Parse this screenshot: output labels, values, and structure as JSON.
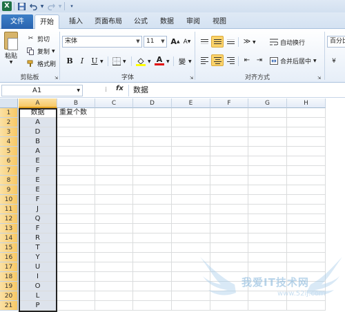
{
  "qat": {
    "app_icon": "X",
    "icons": [
      "save-icon",
      "undo-icon",
      "redo-icon",
      "customize-qat-icon"
    ]
  },
  "tabs": [
    "文件",
    "开始",
    "插入",
    "页面布局",
    "公式",
    "数据",
    "审阅",
    "视图"
  ],
  "ribbon": {
    "clipboard": {
      "paste": "粘贴",
      "cut": "剪切",
      "copy": "复制",
      "format_painter": "格式刷",
      "label": "剪贴板"
    },
    "font": {
      "name": "宋体",
      "size": "11",
      "grow": "A",
      "shrink": "A",
      "bold": "B",
      "italic": "I",
      "underline": "U",
      "font_color_letter": "A",
      "phonetic": "變",
      "label": "字体"
    },
    "alignment": {
      "wrap_text": "自动换行",
      "merge_center": "合并后居中",
      "label": "对齐方式"
    },
    "number": {
      "format": "百分比"
    }
  },
  "formula_bar": {
    "name_box": "A1",
    "fx": "fx",
    "content": "数据"
  },
  "columns": [
    "A",
    "B",
    "C",
    "D",
    "E",
    "F",
    "G",
    "H"
  ],
  "rows": [
    "1",
    "2",
    "3",
    "4",
    "5",
    "6",
    "7",
    "8",
    "9",
    "10",
    "11",
    "12",
    "13",
    "14",
    "15",
    "16",
    "17",
    "18",
    "19",
    "20",
    "21"
  ],
  "cells": {
    "A": [
      "数据",
      "A",
      "D",
      "B",
      "A",
      "E",
      "F",
      "E",
      "E",
      "F",
      "J",
      "Q",
      "F",
      "R",
      "T",
      "Y",
      "U",
      "I",
      "O",
      "L",
      "P"
    ],
    "B1": "重复个数"
  },
  "watermark": {
    "text": "我爱IT技术网",
    "url": "www.52ij.com"
  },
  "colors": {
    "file_tab": "#2a64b0",
    "selected_header": "#f7c865",
    "selection_fill": "#dde3ec",
    "watermark": "#7fb2da"
  }
}
